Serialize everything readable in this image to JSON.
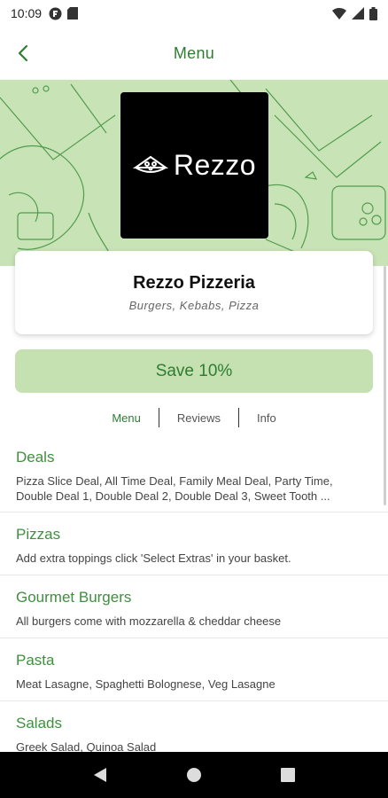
{
  "status_bar": {
    "time": "10:09"
  },
  "app_bar": {
    "title": "Menu"
  },
  "restaurant": {
    "logo_text": "Rezzo",
    "name": "Rezzo Pizzeria",
    "cuisine": "Burgers, Kebabs, Pizza"
  },
  "promo": {
    "label": "Save 10%"
  },
  "tabs": [
    {
      "label": "Menu"
    },
    {
      "label": "Reviews"
    },
    {
      "label": "Info"
    }
  ],
  "categories": [
    {
      "title": "Deals",
      "description": "Pizza Slice Deal, All Time Deal, Family Meal Deal, Party Time, Double Deal 1, Double Deal 2, Double Deal 3, Sweet Tooth ..."
    },
    {
      "title": "Pizzas",
      "description": "Add extra toppings click 'Select Extras' in your basket."
    },
    {
      "title": "Gourmet Burgers",
      "description": "All burgers come with mozzarella & cheddar cheese"
    },
    {
      "title": "Pasta",
      "description": "Meat Lasagne, Spaghetti Bolognese, Veg Lasagne"
    },
    {
      "title": "Salads",
      "description": "Greek Salad, Quinoa Salad"
    }
  ],
  "colors": {
    "accent": "#2e7d32",
    "hero_bg": "#c8e3b6",
    "button_bg": "#c5e0b1"
  }
}
